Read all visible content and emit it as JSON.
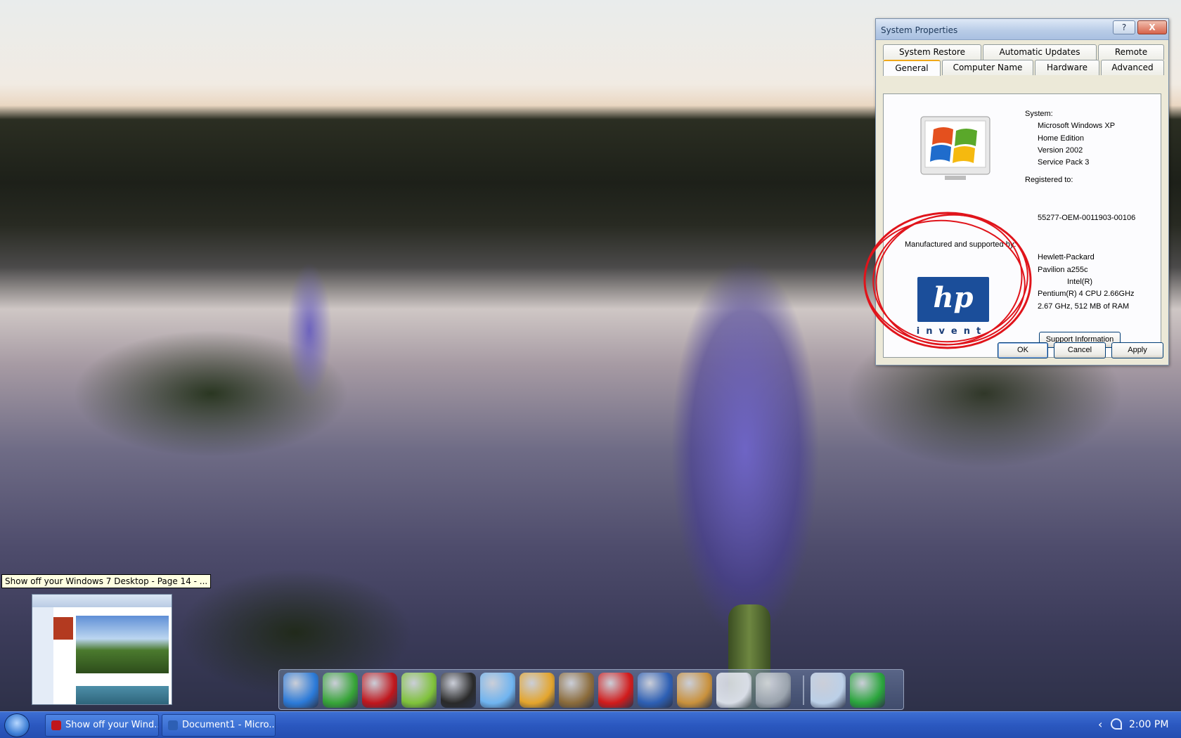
{
  "window": {
    "title": "System Properties",
    "help_label": "?",
    "close_label": "X",
    "tabs_row1": [
      {
        "label": "System Restore"
      },
      {
        "label": "Automatic Updates"
      },
      {
        "label": "Remote"
      }
    ],
    "tabs_row2": [
      {
        "label": "General",
        "active": true
      },
      {
        "label": "Computer Name"
      },
      {
        "label": "Hardware"
      },
      {
        "label": "Advanced"
      }
    ],
    "general": {
      "system_label": "System:",
      "system_lines": [
        "Microsoft Windows XP",
        "Home Edition",
        "Version 2002",
        "Service Pack 3"
      ],
      "registered_label": "Registered to:",
      "product_id": "55277-OEM-0011903-00106",
      "manufacturer_label": "Manufactured and supported by:",
      "manufacturer_lines": [
        "Hewlett-Packard",
        "Pavilion a255c",
        "Intel(R)",
        "Pentium(R) 4 CPU 2.66GHz",
        "2.67 GHz, 512 MB of RAM"
      ],
      "hp_logo_text": "hp",
      "hp_tagline": "invent",
      "support_button": "Support Information"
    },
    "buttons": {
      "ok": "OK",
      "cancel": "Cancel",
      "apply": "Apply"
    }
  },
  "tooltip": "Show off your Windows 7 Desktop - Page 14 - ...",
  "dock_icons": [
    {
      "name": "internet-explorer-icon",
      "color": "#2b7ad8"
    },
    {
      "name": "messenger-icon",
      "color": "#36a437"
    },
    {
      "name": "opera-icon",
      "color": "#c0161c"
    },
    {
      "name": "green-bird-icon",
      "color": "#7fc23a"
    },
    {
      "name": "steam-icon",
      "color": "#2a2a2a"
    },
    {
      "name": "itunes-icon",
      "color": "#6fb4f0"
    },
    {
      "name": "picasa-icon",
      "color": "#e4a52c"
    },
    {
      "name": "toolbox-icon",
      "color": "#8b6b3a"
    },
    {
      "name": "checkmark-icon",
      "color": "#d11b1b"
    },
    {
      "name": "word-icon",
      "color": "#2d5fb4"
    },
    {
      "name": "paint-icon",
      "color": "#c9913c"
    },
    {
      "name": "notepad-icon",
      "color": "#d8dde6"
    },
    {
      "name": "calculator-icon",
      "color": "#9aa3ad"
    },
    {
      "name": "my-computer-icon",
      "color": "#bcd0e8"
    },
    {
      "name": "recycle-bin-icon",
      "color": "#2aa53c"
    }
  ],
  "taskbar": {
    "tasks": [
      {
        "label": "Show off your Wind...",
        "icon_color": "#c0161c"
      },
      {
        "label": "Document1 - Micro...",
        "icon_color": "#2d5fb4"
      }
    ],
    "clock": "2:00 PM",
    "tray_chevron": "‹"
  }
}
